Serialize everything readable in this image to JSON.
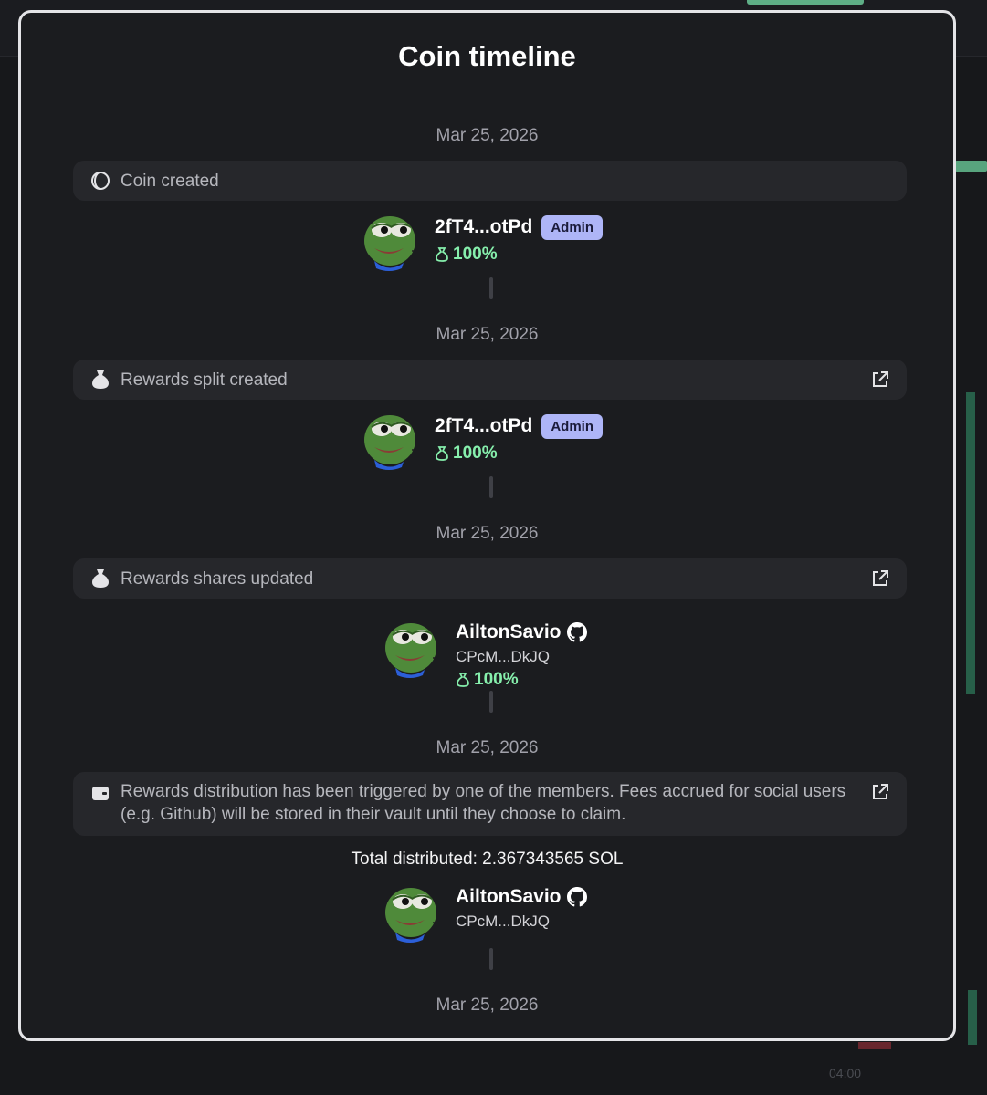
{
  "modal": {
    "title": "Coin timeline"
  },
  "colors": {
    "accent_green": "#86efac",
    "badge_bg": "#aeb5f7",
    "panel_bg": "#1b1c1f",
    "event_bg": "#26272b"
  },
  "background": {
    "chart_time_label": "04:00"
  },
  "events": [
    {
      "date": "Mar 25, 2026",
      "icon": "coin-icon",
      "text": "Coin created",
      "has_link": false,
      "members": [
        {
          "name": "2fT4...otPd",
          "badge": "Admin",
          "share": "100%"
        }
      ]
    },
    {
      "date": "Mar 25, 2026",
      "icon": "money-bag-icon",
      "text": "Rewards split created",
      "has_link": true,
      "members": [
        {
          "name": "2fT4...otPd",
          "badge": "Admin",
          "share": "100%"
        }
      ]
    },
    {
      "date": "Mar 25, 2026",
      "icon": "money-bag-icon",
      "text": "Rewards shares updated",
      "has_link": true,
      "members": [
        {
          "name": "AiltonSavio",
          "platform_icon": "github-icon",
          "address": "CPcM...DkJQ",
          "share": "100%"
        }
      ]
    },
    {
      "date": "Mar 25, 2026",
      "icon": "wallet-icon",
      "text": "Rewards distribution has been triggered by one of the members. Fees accrued for social users (e.g. Github) will be stored in their vault until they choose to claim.",
      "has_link": true,
      "total_distributed": "Total distributed: 2.367343565 SOL",
      "members": [
        {
          "name": "AiltonSavio",
          "platform_icon": "github-icon",
          "address": "CPcM...DkJQ"
        }
      ]
    },
    {
      "date": "Mar 25, 2026"
    }
  ]
}
